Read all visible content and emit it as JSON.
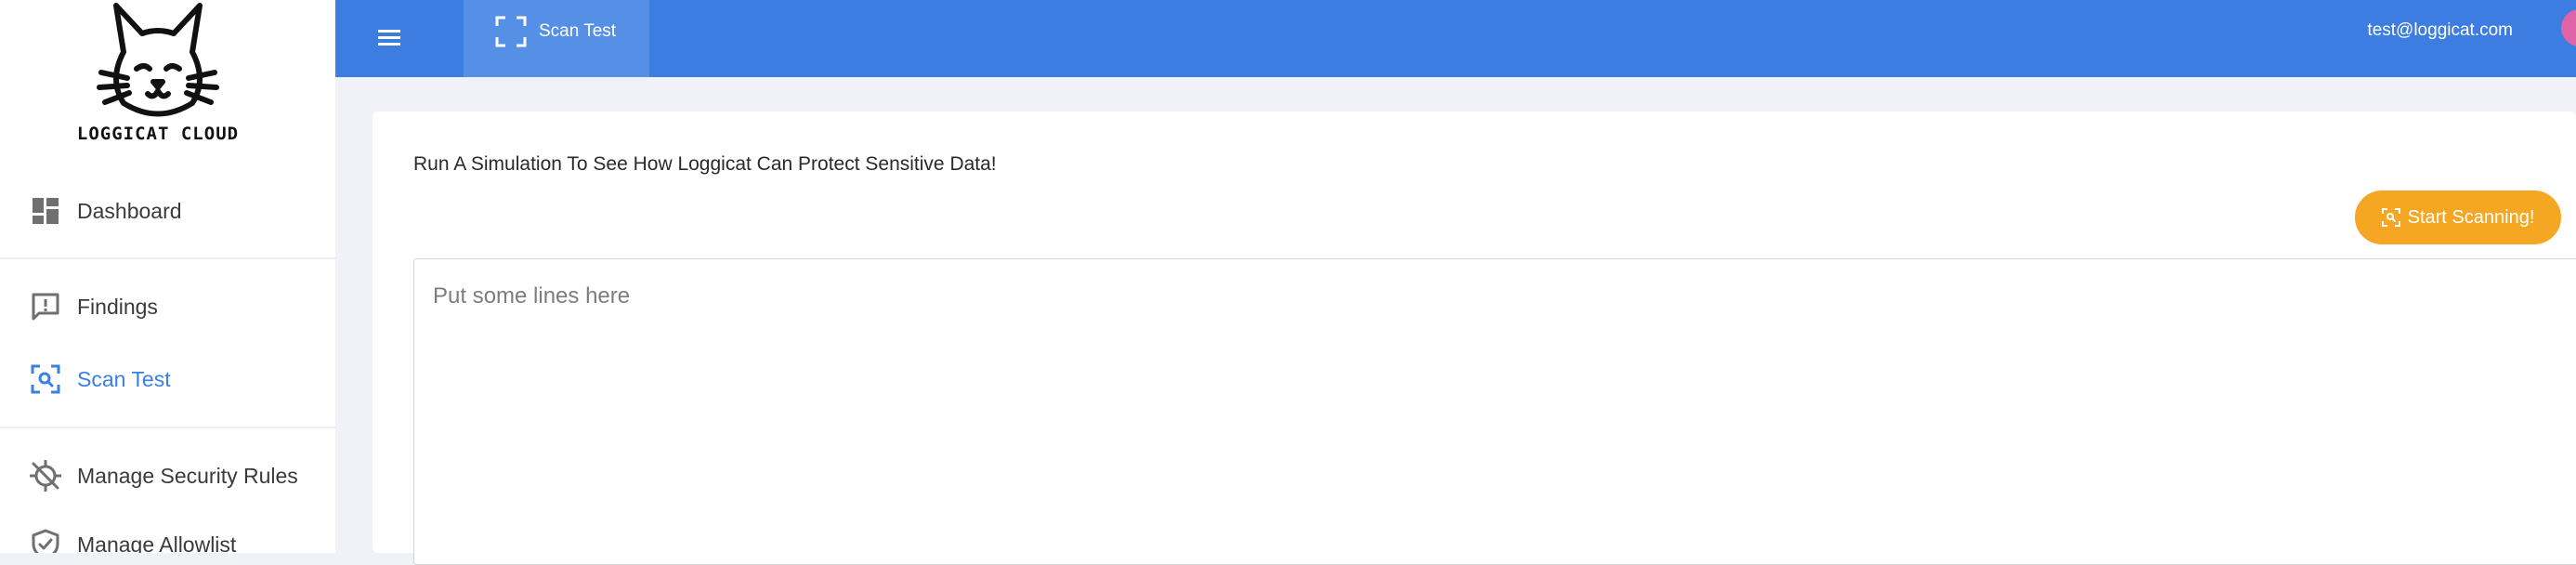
{
  "brand": {
    "name": "LOGGICAT CLOUD"
  },
  "sidebar": {
    "items": [
      {
        "label": "Dashboard",
        "icon": "dashboard-icon"
      },
      {
        "label": "Findings",
        "icon": "alert-comment-icon"
      },
      {
        "label": "Scan Test",
        "icon": "scan-search-icon",
        "active": true
      },
      {
        "label": "Manage Security Rules",
        "icon": "gps-off-icon"
      },
      {
        "label": "Manage Allowlist",
        "icon": "shield-check-icon"
      }
    ]
  },
  "topbar": {
    "menu_icon": "hamburger-menu-icon",
    "tab_label": "Scan Test",
    "tab_icon": "scan-frame-icon",
    "user_email": "test@loggicat.com"
  },
  "main": {
    "headline": "Run A Simulation To See How Loggicat Can Protect Sensitive Data!",
    "scan_button_label": "Start Scanning!",
    "textarea_placeholder": "Put some lines here"
  },
  "colors": {
    "topbar": "#3d7ce0",
    "active_tab": "#5590e6",
    "active_nav": "#3b7fe0",
    "scan_button": "#f5a623",
    "avatar": "#e063a7"
  }
}
